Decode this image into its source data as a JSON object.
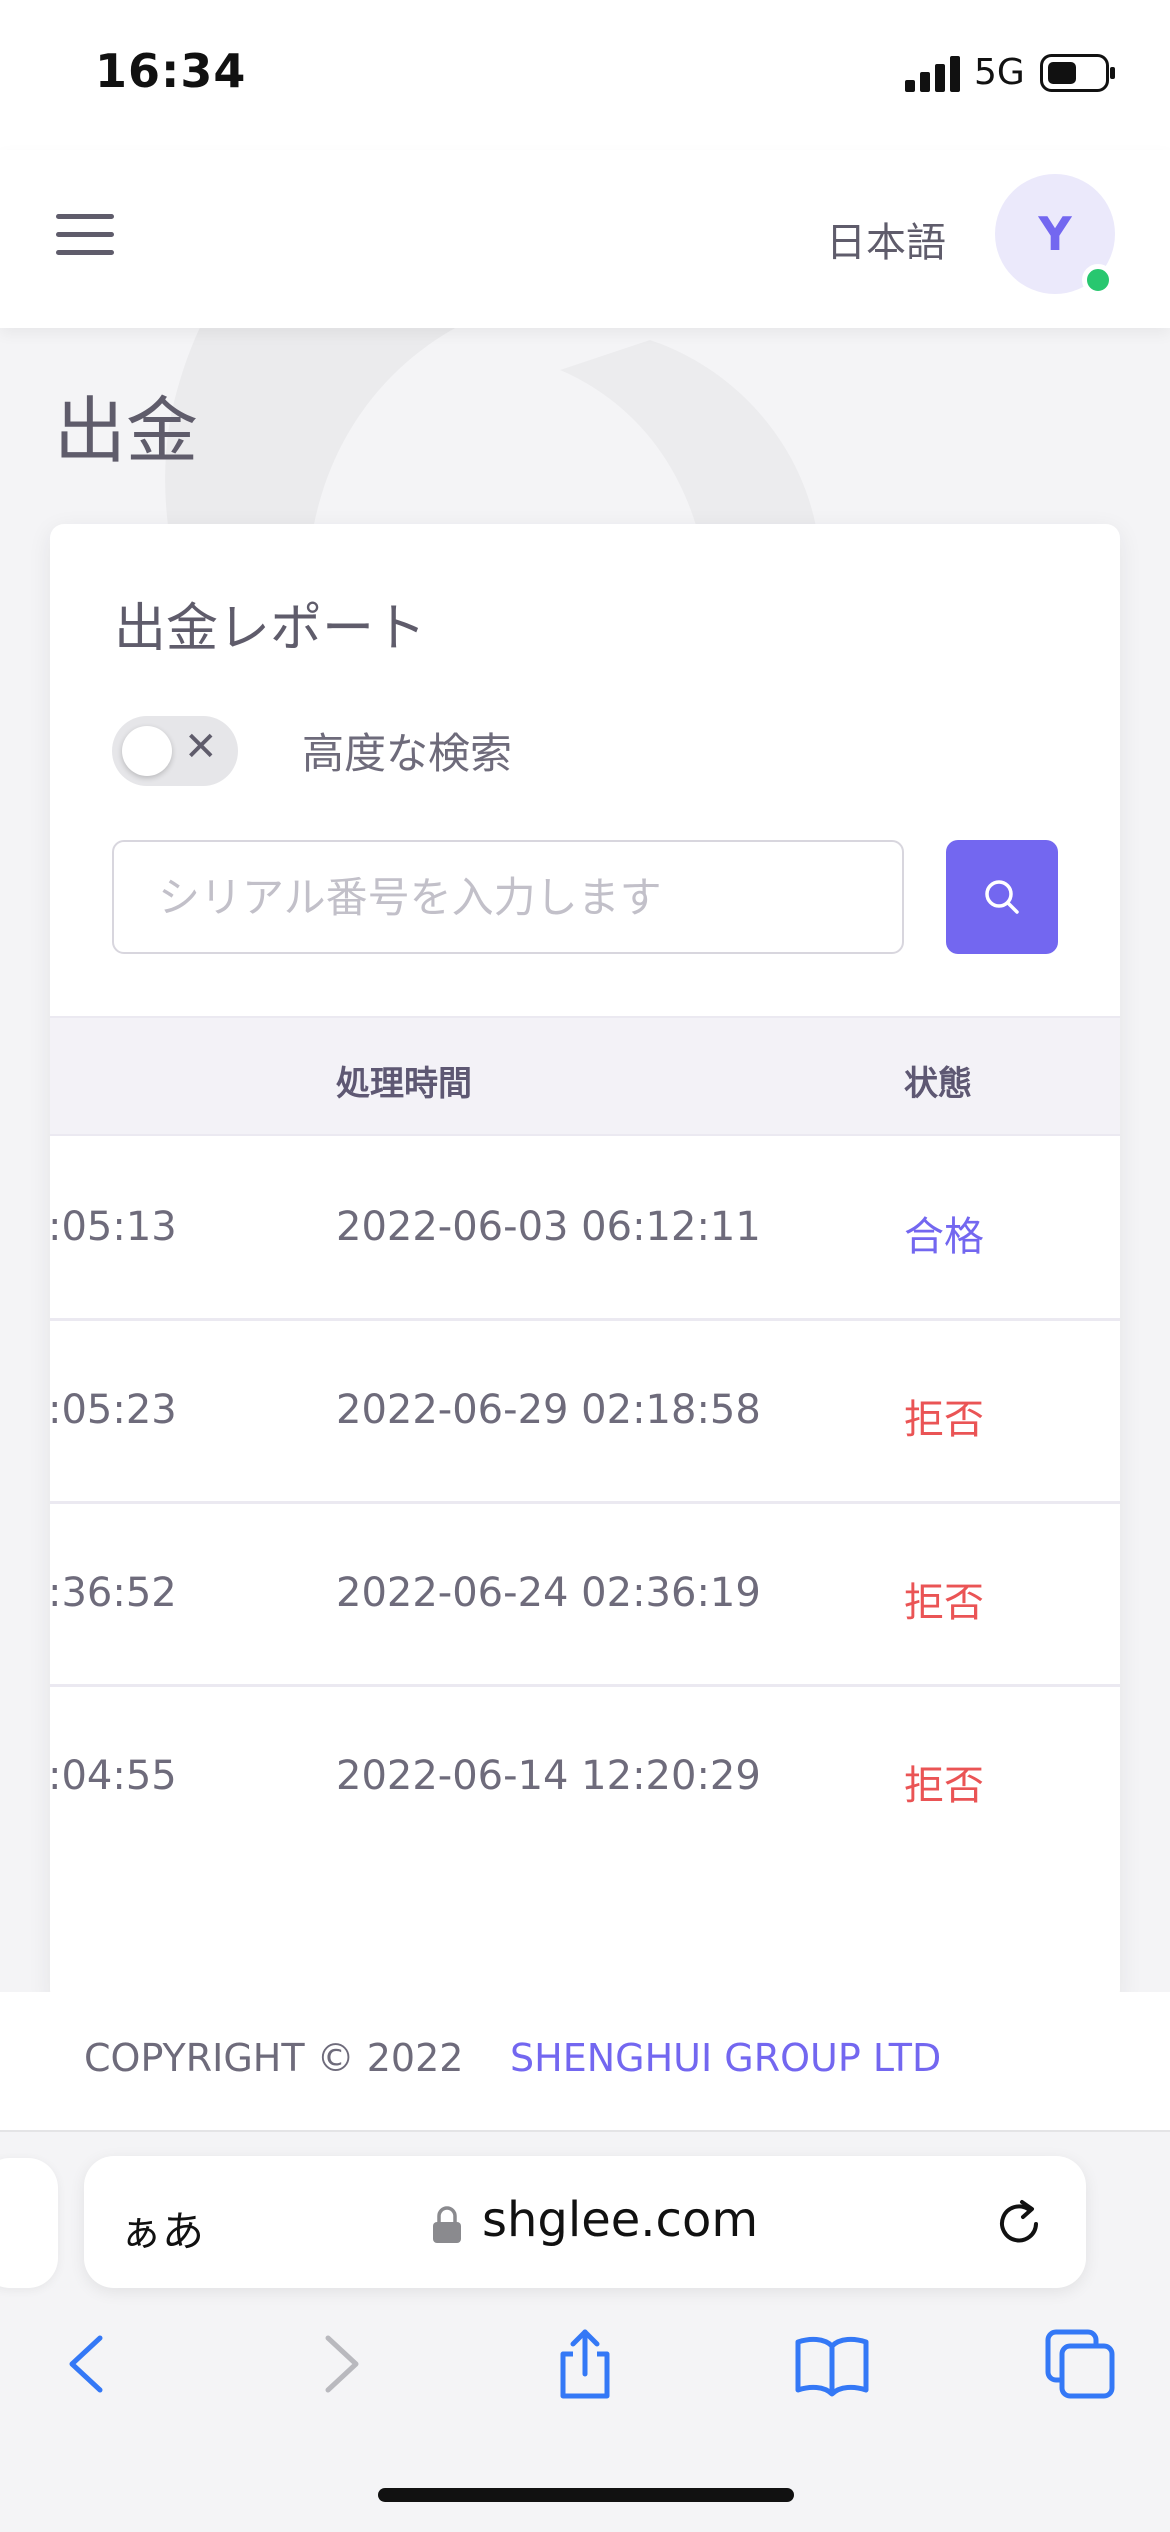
{
  "status_bar": {
    "time": "16:34",
    "network": "5G"
  },
  "header": {
    "language": "日本語",
    "avatar_initial": "Y"
  },
  "page": {
    "title": "出金"
  },
  "card": {
    "title": "出金レポート",
    "advanced_search_label": "高度な検索",
    "toggle_off_symbol": "✕",
    "search_placeholder": "シリアル番号を入力します"
  },
  "table": {
    "columns": [
      "処理時間",
      "状態"
    ],
    "rows": [
      {
        "created": ":05:13",
        "processed": "2022-06-03 06:12:11",
        "status": "合格"
      },
      {
        "created": ":05:23",
        "processed": "2022-06-29 02:18:58",
        "status": "拒否"
      },
      {
        "created": ":36:52",
        "processed": "2022-06-24 02:36:19",
        "status": "拒否"
      },
      {
        "created": ":04:55",
        "processed": "2022-06-14 12:20:29",
        "status": "拒否"
      }
    ]
  },
  "footer": {
    "copyright": "COPYRIGHT © 2022",
    "company": "SHENGHUI GROUP LTD"
  },
  "browser": {
    "text_size_label": "ぁあ",
    "domain": "shglee.com"
  },
  "colors": {
    "primary": "#7367f0",
    "danger": "#ea5455",
    "success_dot": "#28c76f"
  }
}
